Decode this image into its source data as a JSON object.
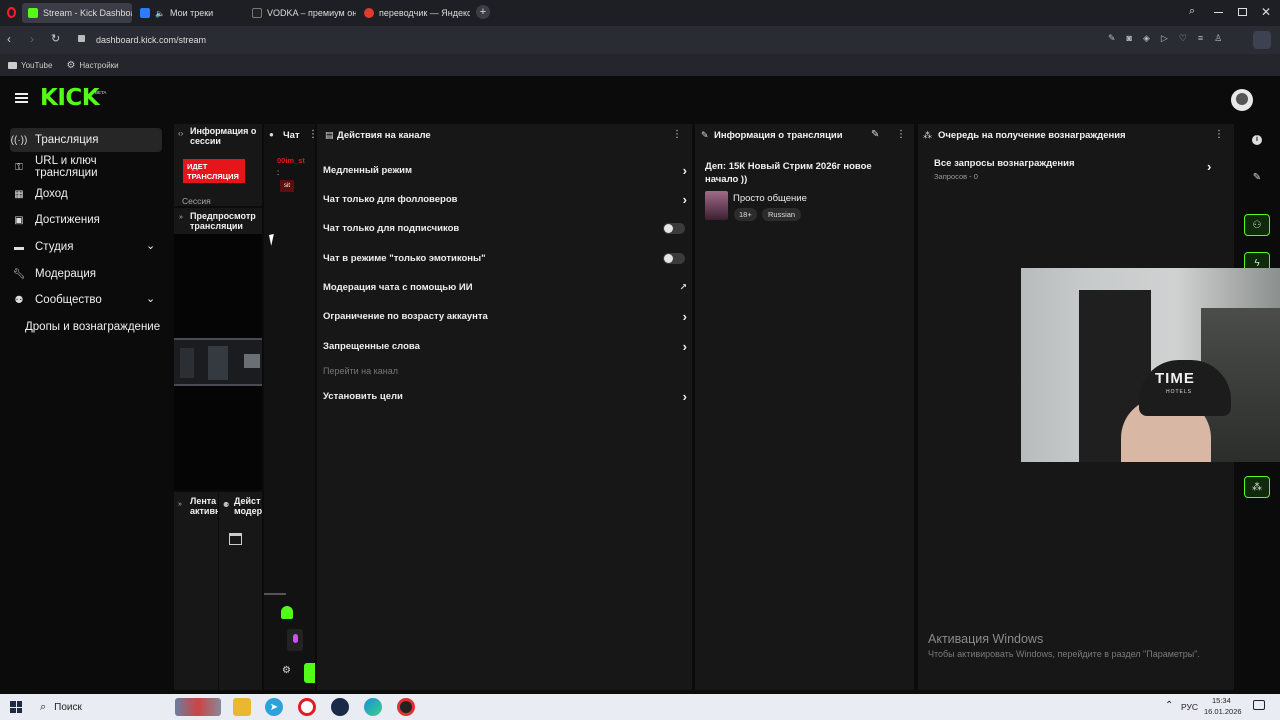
{
  "browser": {
    "tabs": [
      {
        "label": "Stream - Kick Dashboard",
        "color": "#53fc18"
      },
      {
        "label": "Мои треки",
        "color": "#2b7bff"
      },
      {
        "label": "VODKA – премиум онла",
        "color": "#888888"
      },
      {
        "label": "переводчик — Яндекс: н",
        "color": "#e23b2e"
      }
    ],
    "url": "dashboard.kick.com/stream",
    "bookmarks": [
      "YouTube",
      "Настройки"
    ]
  },
  "app": {
    "logo": "KICK",
    "logo_badge": "BETA",
    "accent": "#53fc18"
  },
  "sidebar": {
    "items": [
      {
        "label": "Трансляция",
        "icon": "broadcast-icon"
      },
      {
        "label": "URL и ключ трансляции",
        "icon": "key-icon"
      },
      {
        "label": "Доход",
        "icon": "money-icon"
      },
      {
        "label": "Достижения",
        "icon": "trophy-icon"
      },
      {
        "label": "Студия",
        "icon": "studio-icon"
      },
      {
        "label": "Модерация",
        "icon": "wrench-icon"
      },
      {
        "label": "Сообщество",
        "icon": "people-icon"
      },
      {
        "label": "Дропы и вознаграждение",
        "icon": ""
      }
    ]
  },
  "session": {
    "title": "Информация о сессии",
    "live_badge": "ИДЕТ ТРАНСЛЯЦИЯ",
    "session_label": "Сессия",
    "preview_title": "Предпросмотр трансляции",
    "feed_title": "Лента активн",
    "mod_title": "Дейст модер"
  },
  "chat": {
    "title": "Чат",
    "username": "00im_st",
    "message": "sit"
  },
  "actions": {
    "title": "Действия на канале",
    "items": [
      {
        "label": "Медленный режим",
        "control": "chevron"
      },
      {
        "label": "Чат только для фолловеров",
        "control": "chevron"
      },
      {
        "label": "Чат только для подписчиков",
        "control": "toggle"
      },
      {
        "label": "Чат в режиме \"только эмотиконы\"",
        "control": "toggle"
      },
      {
        "label": "Модерация чата с помощью ИИ",
        "control": "external"
      },
      {
        "label": "Ограничение по возрасту аккаунта",
        "control": "chevron"
      },
      {
        "label": "Запрещенные слова",
        "control": "chevron"
      },
      {
        "label": "Перейти на канал",
        "control": "none"
      },
      {
        "label": "Установить цели",
        "control": "chevron"
      }
    ]
  },
  "stream_info": {
    "title": "Информация о трансляции",
    "stream_title": "Деп: 15К Новый Стрим 2026г новое начало ))",
    "category": "Просто общение",
    "tags": [
      "18+",
      "Russian"
    ]
  },
  "rewards": {
    "title": "Очередь на получение вознаграждения",
    "all_requests": "Все запросы вознаграждения",
    "requests_count": "Запросов - 0"
  },
  "webcam": {
    "cap_text": "TIME",
    "cap_subtext": "HOTELS"
  },
  "watermark": {
    "title": "Активация Windows",
    "subtitle": "Чтобы активировать Windows, перейдите в раздел \"Параметры\"."
  },
  "taskbar": {
    "search": "Поиск",
    "lang": "РУС",
    "time": "15:34",
    "date": "16.01.2026"
  }
}
